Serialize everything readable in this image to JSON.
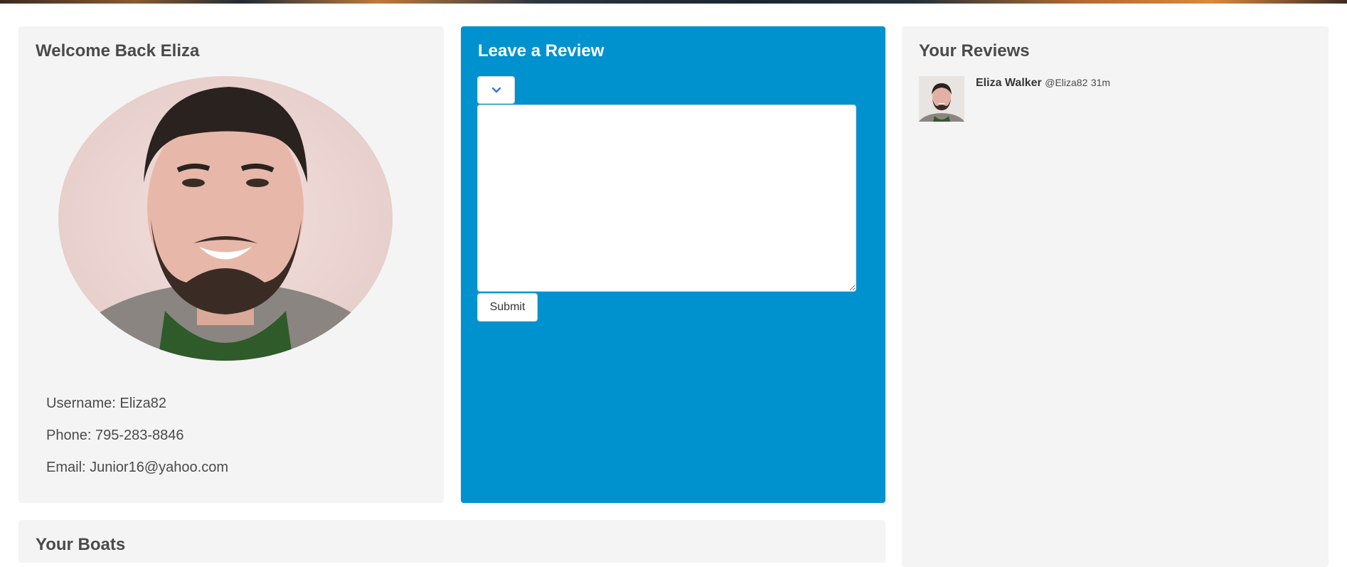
{
  "welcome": {
    "title": "Welcome Back Eliza",
    "username": "Username: Eliza82",
    "phone": "Phone: 795-283-8846",
    "email": "Email: Junior16@yahoo.com"
  },
  "review_form": {
    "title": "Leave a Review",
    "select_icon": "chevron-down-icon",
    "textarea_value": "",
    "submit_label": "Submit"
  },
  "your_reviews": {
    "title": "Your Reviews",
    "items": [
      {
        "author": "Eliza Walker",
        "handle": "@Eliza82",
        "time": "31m"
      }
    ]
  },
  "boats": {
    "title": "Your Boats"
  },
  "colors": {
    "review_panel": "#0092cf",
    "card_bg": "#f4f4f4",
    "text": "#4a4a4a",
    "chevron": "#3273dc"
  }
}
